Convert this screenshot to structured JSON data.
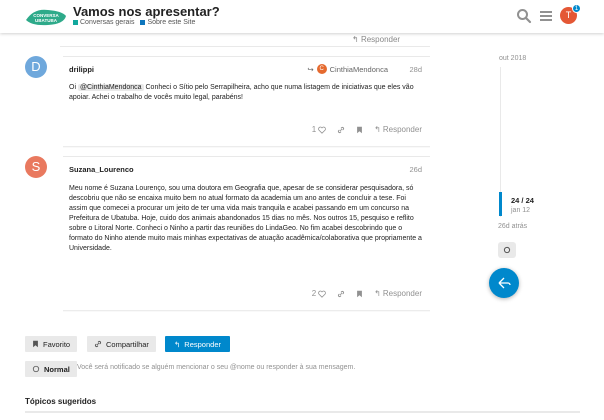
{
  "header": {
    "logo_text": "CONVERSA UBATUBA",
    "topic_title": "Vamos nos apresentar?",
    "categories": [
      {
        "name": "Conversas gerais",
        "color": "#12a89d"
      },
      {
        "name": "Sobre este Site",
        "color": "#0e76bd"
      }
    ],
    "user_avatar_letter": "T",
    "notification_count": "1"
  },
  "stub": {
    "reply_label": "Responder"
  },
  "posts": [
    {
      "avatar_letter": "D",
      "avatar_color": "#6fa8dc",
      "username": "drilippi",
      "reply_to_name": "CinthiaMendonca",
      "reply_to_letter": "C",
      "date": "28d",
      "text_before": "Oi ",
      "mention": "@CinthiaMendonca",
      "text_after": " Conheci o Sítio pelo Serrapilheira, acho que numa listagem de iniciativas que eles vão apoiar. Achei o trabalho de vocês muito legal, parabéns!",
      "likes": "1",
      "reply_label": "Responder"
    },
    {
      "avatar_letter": "S",
      "avatar_color": "#e9795f",
      "username": "Suzana_Lourenco",
      "date": "26d",
      "text": "Meu nome é Suzana Lourenço, sou uma doutora em Geografia que, apesar de se considerar pesquisadora, só descobriu que não se encaixa muito bem no atual formato da academia um ano antes de concluir a tese. Foi assim que comecei a procurar um jeito de ter uma vida mais tranquila e acabei passando em um concurso na Prefeitura de Ubatuba. Hoje, cuido dos animais abandonados 15 dias no mês. Nos outros 15, pesquiso e reflito sobre o Litoral Norte. Conheci o Ninho a partir das reuniões do LindaGeo. No fim acabei descobrindo que o formato do Ninho atende muito mais minhas expectativas de atuação acadêmica/colaborativa que propriamente a Universidade.",
      "likes": "2",
      "reply_label": "Responder"
    }
  ],
  "timeline": {
    "start_date": "out 2018",
    "position": "24 / 24",
    "position_date": "jan 12",
    "last_activity": "26d atrás"
  },
  "footer": {
    "bookmark_label": "Favorito",
    "share_label": "Compartilhar",
    "reply_label": "Responder",
    "notification_level": "Normal",
    "notification_text": "Você será notificado se alguém mencionar o seu @nome ou responder à sua mensagem.",
    "suggested_title": "Tópicos sugeridos"
  },
  "colors": {
    "accent": "#0088cc",
    "muted": "#919191"
  }
}
